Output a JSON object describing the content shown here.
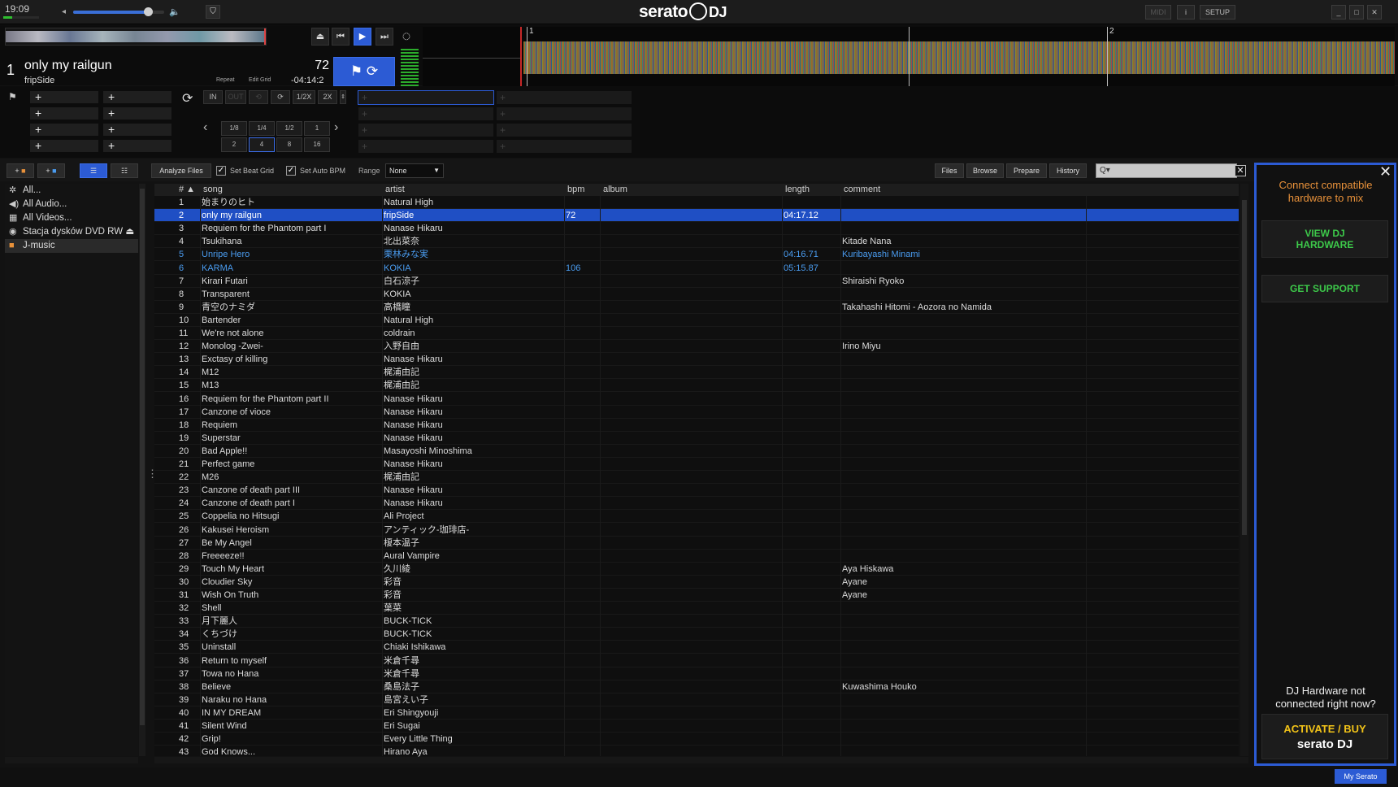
{
  "topbar": {
    "clock": "19:09",
    "clock_progress": 0.25,
    "volume_level": 0.82,
    "volume_left_icon": "◂",
    "volume_right_icon": "🔈",
    "logo": "serato",
    "logo_dj": "DJ",
    "midi_label": "MIDI",
    "info_label": "i",
    "setup_label": "SETUP",
    "min_label": "_",
    "max_label": "□",
    "close_label": "✕"
  },
  "deck": {
    "number": "1",
    "title": "only my railgun",
    "artist": "fripSide",
    "bpm": "72",
    "remaining": "-04:14:2",
    "repeat_label": "Repeat",
    "edit_grid_label": "Edit Grid",
    "beat_markers": [
      "1",
      "2"
    ]
  },
  "loop": {
    "in": "IN",
    "out": "OUT",
    "half": "1/2X",
    "double": "2X",
    "auto_sizes": [
      "1/8",
      "1/4",
      "1/2",
      "1",
      "2",
      "4",
      "8",
      "16"
    ],
    "selected_auto": "4"
  },
  "library": {
    "analyze_files": "Analyze Files",
    "set_beat_grid": "Set Beat Grid",
    "set_auto_bpm": "Set Auto BPM",
    "range_label": "Range",
    "range_value": "None",
    "files": "Files",
    "browse": "Browse",
    "prepare": "Prepare",
    "history": "History",
    "search_placeholder": "Q▾"
  },
  "sidebar": {
    "items": [
      {
        "label": "All...",
        "icon": "star-icon"
      },
      {
        "label": "All Audio...",
        "icon": "speaker-icon"
      },
      {
        "label": "All Videos...",
        "icon": "film-icon"
      },
      {
        "label": "Stacja dysków DVD RW",
        "icon": "disc-icon"
      },
      {
        "label": "J-music",
        "icon": "crate-icon"
      }
    ]
  },
  "table": {
    "headers": [
      "#",
      "song",
      "artist",
      "bpm",
      "album",
      "length",
      "comment"
    ],
    "rows": [
      [
        "1",
        "始まりのヒト",
        "Natural High",
        "",
        "",
        "",
        ""
      ],
      [
        "2",
        "only my railgun",
        "fripSide",
        "72",
        "",
        "04:17.12",
        ""
      ],
      [
        "3",
        "Requiem for the Phantom part I",
        "Nanase Hikaru",
        "",
        "",
        "",
        ""
      ],
      [
        "4",
        "Tsukihana",
        "北出菜奈",
        "",
        "",
        "",
        "Kitade Nana"
      ],
      [
        "5",
        "Unripe Hero",
        "栗林みな実",
        "",
        "",
        "04:16.71",
        "Kuribayashi Minami"
      ],
      [
        "6",
        "KARMA",
        "KOKIA",
        "106",
        "",
        "05:15.87",
        ""
      ],
      [
        "7",
        "Kirari Futari",
        "白石涼子",
        "",
        "",
        "",
        "Shiraishi Ryoko"
      ],
      [
        "8",
        "Transparent",
        "KOKIA",
        "",
        "",
        "",
        ""
      ],
      [
        "9",
        "青空のナミダ",
        "高橋瞳",
        "",
        "",
        "",
        "Takahashi Hitomi - Aozora no Namida"
      ],
      [
        "10",
        "Bartender",
        "Natural High",
        "",
        "",
        "",
        ""
      ],
      [
        "11",
        "We're not alone",
        "coldrain",
        "",
        "",
        "",
        ""
      ],
      [
        "12",
        "Monolog -Zwei-",
        "入野自由",
        "",
        "",
        "",
        "Irino Miyu"
      ],
      [
        "13",
        "Exctasy of killing",
        "Nanase Hikaru",
        "",
        "",
        "",
        ""
      ],
      [
        "14",
        "M12",
        "梶浦由記",
        "",
        "",
        "",
        ""
      ],
      [
        "15",
        "M13",
        "梶浦由記",
        "",
        "",
        "",
        ""
      ],
      [
        "16",
        "Requiem for the Phantom part II",
        "Nanase Hikaru",
        "",
        "",
        "",
        ""
      ],
      [
        "17",
        "Canzone of vioce",
        "Nanase Hikaru",
        "",
        "",
        "",
        ""
      ],
      [
        "18",
        "Requiem",
        "Nanase Hikaru",
        "",
        "",
        "",
        ""
      ],
      [
        "19",
        "Superstar",
        "Nanase Hikaru",
        "",
        "",
        "",
        ""
      ],
      [
        "20",
        "Bad Apple!!",
        "Masayoshi Minoshima",
        "",
        "",
        "",
        ""
      ],
      [
        "21",
        "Perfect game",
        "Nanase Hikaru",
        "",
        "",
        "",
        ""
      ],
      [
        "22",
        "M26",
        "梶浦由記",
        "",
        "",
        "",
        ""
      ],
      [
        "23",
        "Canzone of death part III",
        "Nanase Hikaru",
        "",
        "",
        "",
        ""
      ],
      [
        "24",
        "Canzone of death part I",
        "Nanase Hikaru",
        "",
        "",
        "",
        ""
      ],
      [
        "25",
        "Coppelia no Hitsugi",
        "Ali Project",
        "",
        "",
        "",
        ""
      ],
      [
        "26",
        "Kakusei Heroism",
        "アンティック-珈琲店-",
        "",
        "",
        "",
        ""
      ],
      [
        "27",
        "Be My Angel",
        "榎本温子",
        "",
        "",
        "",
        ""
      ],
      [
        "28",
        "Freeeeze!!",
        "Aural Vampire",
        "",
        "",
        "",
        ""
      ],
      [
        "29",
        "Touch My Heart",
        "久川綾",
        "",
        "",
        "",
        "Aya Hiskawa"
      ],
      [
        "30",
        "Cloudier Sky",
        "彩音",
        "",
        "",
        "",
        "Ayane"
      ],
      [
        "31",
        "Wish On Truth",
        "彩音",
        "",
        "",
        "",
        "Ayane"
      ],
      [
        "32",
        "Shell",
        "葉菜",
        "",
        "",
        "",
        ""
      ],
      [
        "33",
        "月下麗人",
        "BUCK-TICK",
        "",
        "",
        "",
        ""
      ],
      [
        "34",
        "くちづけ",
        "BUCK-TICK",
        "",
        "",
        "",
        ""
      ],
      [
        "35",
        "Uninstall",
        "Chiaki Ishikawa",
        "",
        "",
        "",
        ""
      ],
      [
        "36",
        "Return to myself",
        "米倉千尋",
        "",
        "",
        "",
        ""
      ],
      [
        "37",
        "Towa no Hana",
        "米倉千尋",
        "",
        "",
        "",
        ""
      ],
      [
        "38",
        "Believe",
        "桑島法子",
        "",
        "",
        "",
        "Kuwashima Houko"
      ],
      [
        "39",
        "Naraku no Hana",
        "島宮えい子",
        "",
        "",
        "",
        ""
      ],
      [
        "40",
        "IN MY DREAM",
        "Eri Shingyouji",
        "",
        "",
        "",
        ""
      ],
      [
        "41",
        "Silent Wind",
        "Eri Sugai",
        "",
        "",
        "",
        ""
      ],
      [
        "42",
        "Grip!",
        "Every Little Thing",
        "",
        "",
        "",
        ""
      ],
      [
        "43",
        "God Knows...",
        "Hirano Aya",
        "",
        "",
        "",
        ""
      ]
    ]
  },
  "panel": {
    "connect_text": "Connect compatible hardware to mix",
    "view_hw_line1": "VIEW DJ",
    "view_hw_line2": "HARDWARE",
    "get_support": "GET SUPPORT",
    "not_connected": "DJ Hardware not connected right now?",
    "activate": "ACTIVATE / BUY",
    "activate_logo": "serato DJ",
    "close": "✕"
  },
  "status": {
    "my_serato": "My Serato"
  },
  "colors": {
    "accent_blue": "#2c5bd4",
    "orange": "#e8913a",
    "green": "#3dc94a",
    "yellow": "#f2c318",
    "link_blue": "#4a9cf0"
  }
}
